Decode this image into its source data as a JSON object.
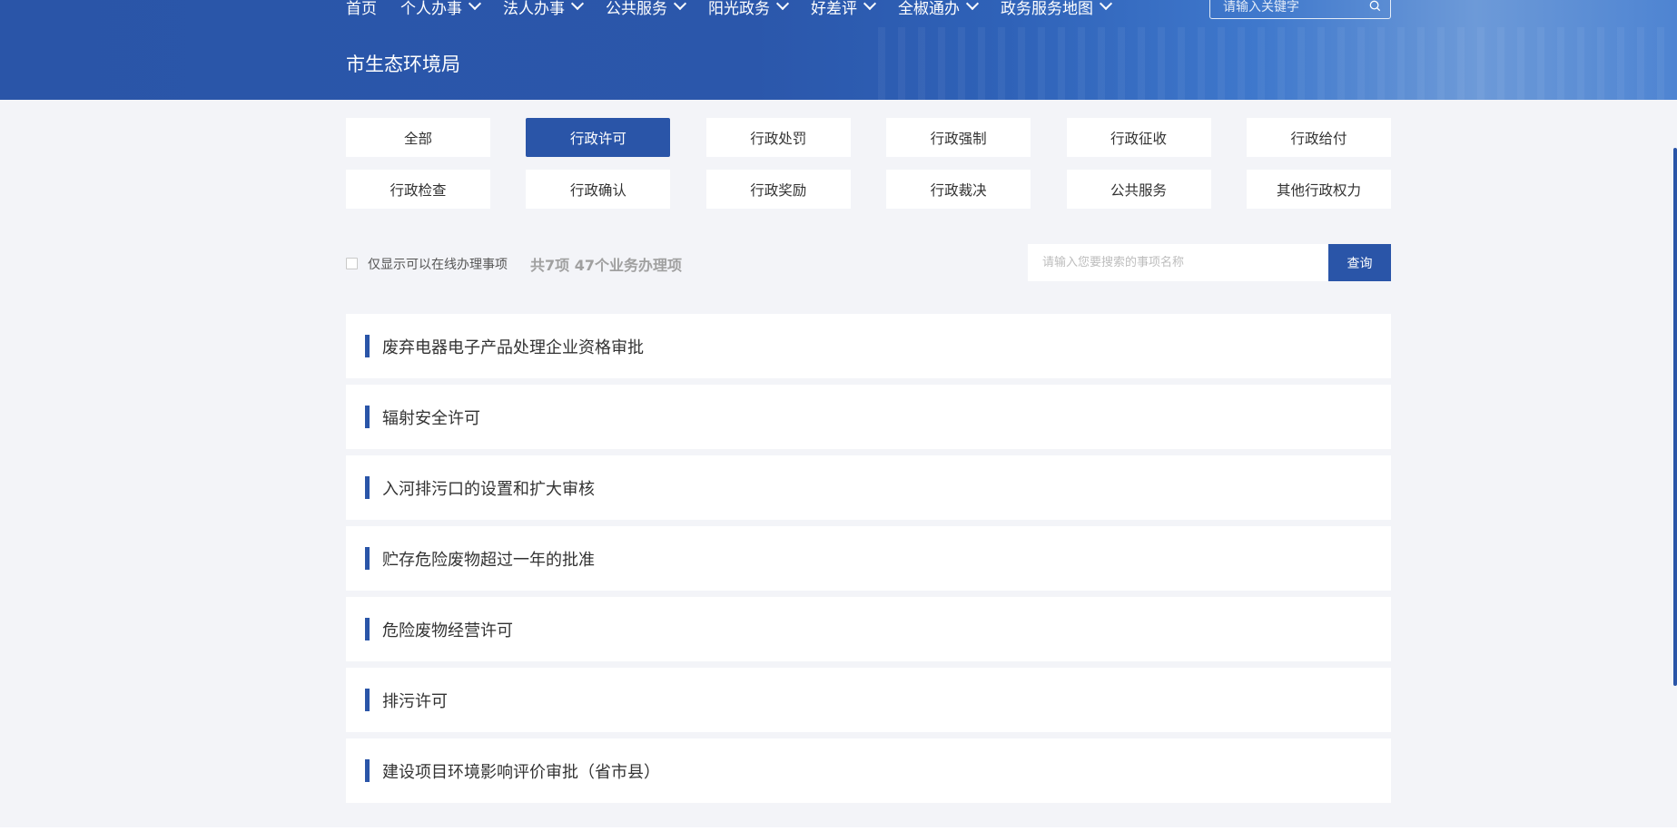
{
  "nav": {
    "items": [
      {
        "label": "首页",
        "dropdown": false
      },
      {
        "label": "个人办事",
        "dropdown": true
      },
      {
        "label": "法人办事",
        "dropdown": true
      },
      {
        "label": "公共服务",
        "dropdown": true
      },
      {
        "label": "阳光政务",
        "dropdown": true
      },
      {
        "label": "好差评",
        "dropdown": true
      },
      {
        "label": "全椒通办",
        "dropdown": true
      },
      {
        "label": "政务服务地图",
        "dropdown": true
      }
    ],
    "search_placeholder": "请输入关键字"
  },
  "site": {
    "title": "市生态环境局"
  },
  "categories": [
    {
      "label": "全部",
      "active": false
    },
    {
      "label": "行政许可",
      "active": true
    },
    {
      "label": "行政处罚",
      "active": false
    },
    {
      "label": "行政强制",
      "active": false
    },
    {
      "label": "行政征收",
      "active": false
    },
    {
      "label": "行政给付",
      "active": false
    },
    {
      "label": "行政检查",
      "active": false
    },
    {
      "label": "行政确认",
      "active": false
    },
    {
      "label": "行政奖励",
      "active": false
    },
    {
      "label": "行政裁决",
      "active": false
    },
    {
      "label": "公共服务",
      "active": false
    },
    {
      "label": "其他行政权力",
      "active": false
    }
  ],
  "filter": {
    "online_only_label": "仅显示可以在线办理事项",
    "online_only_checked": false,
    "count_text": "共7项 47个业务办理项",
    "search_placeholder": "请输入您要搜索的事项名称",
    "query_label": "查询"
  },
  "items": [
    "废弃电器电子产品处理企业资格审批",
    "辐射安全许可",
    "入河排污口的设置和扩大审核",
    "贮存危险废物超过一年的批准",
    "危险废物经营许可",
    "排污许可",
    "建设项目环境影响评价审批（省市县）"
  ],
  "colors": {
    "primary": "#2a55a8",
    "background": "#f3f4f8"
  }
}
